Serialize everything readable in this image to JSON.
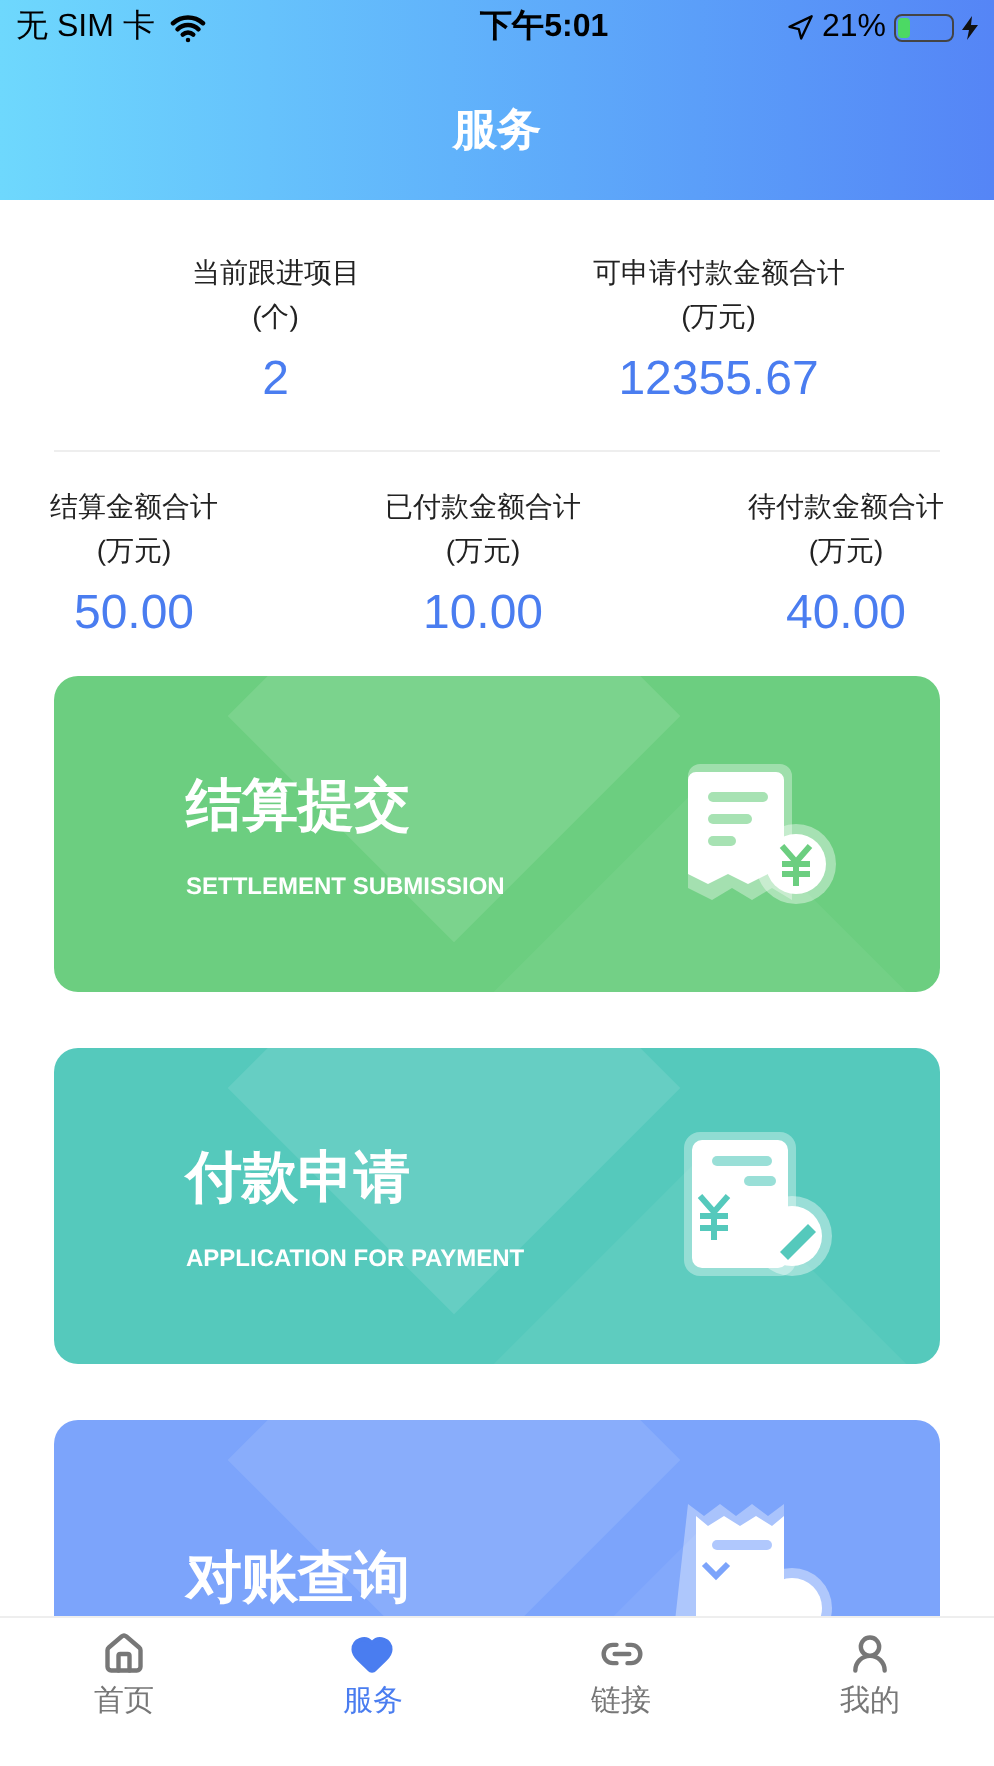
{
  "status_bar": {
    "carrier": "无 SIM 卡",
    "time": "下午5:01",
    "battery": "21%"
  },
  "header": {
    "title": "服务"
  },
  "summary_top": [
    {
      "label": "当前跟进项目",
      "unit": "(个)",
      "value": "2"
    },
    {
      "label": "可申请付款金额合计",
      "unit": "(万元)",
      "value": "12355.67"
    }
  ],
  "summary_bottom": [
    {
      "label": "结算金额合计",
      "unit": "(万元)",
      "value": "50.00"
    },
    {
      "label": "已付款金额合计",
      "unit": "(万元)",
      "value": "10.00"
    },
    {
      "label": "待付款金额合计",
      "unit": "(万元)",
      "value": "40.00"
    }
  ],
  "cards": [
    {
      "kind": "settlement",
      "title": "结算提交",
      "subtitle": "SETTLEMENT SUBMISSION",
      "color": "#6cce80"
    },
    {
      "kind": "payment",
      "title": "付款申请",
      "subtitle": "APPLICATION FOR PAYMENT",
      "color": "#55c9bc"
    },
    {
      "kind": "reconcile",
      "title": "对账查询",
      "color": "#7ca4fb"
    }
  ],
  "tab_bar": [
    {
      "kind": "home",
      "label": "首页",
      "selected": false
    },
    {
      "kind": "service",
      "label": "服务",
      "selected": true
    },
    {
      "kind": "link",
      "label": "链接",
      "selected": false
    },
    {
      "kind": "mine",
      "label": "我的",
      "selected": false
    }
  ]
}
